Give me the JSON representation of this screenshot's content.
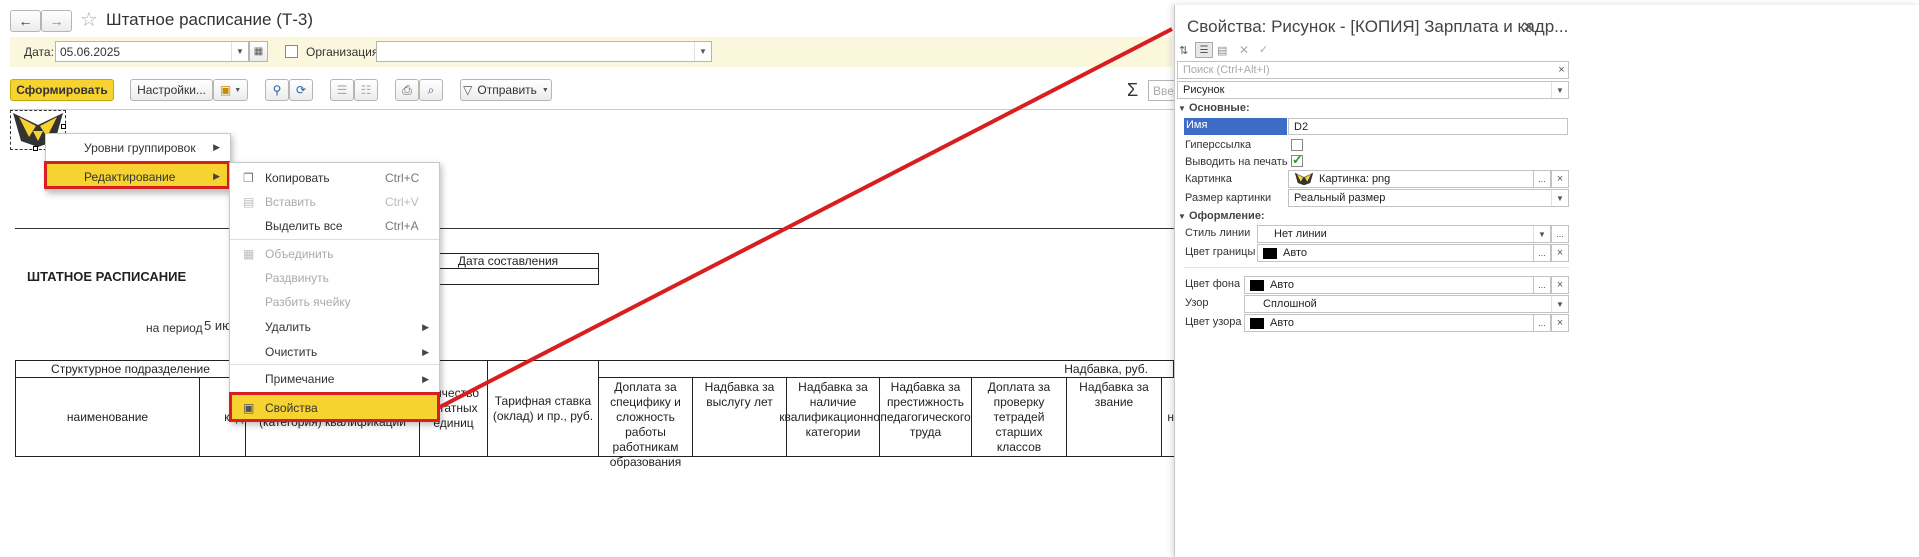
{
  "window": {
    "title": "Штатное расписание (Т-3)"
  },
  "filter": {
    "date_label": "Дата:",
    "date_value": "05.06.2025",
    "org_label": "Организация:",
    "org_value": ""
  },
  "toolbar": {
    "generate_label": "Сформировать",
    "settings_label": "Настройки...",
    "send_label": "Отправить",
    "sigma": "Σ",
    "search_placeholder": "Введ"
  },
  "context_menu": {
    "items": [
      {
        "label": "Уровни группировок",
        "arrow": "▶"
      },
      {
        "label": "Редактирование",
        "arrow": "▶"
      }
    ]
  },
  "edit_menu": {
    "items": [
      {
        "label": "Копировать",
        "shortcut": "Ctrl+C"
      },
      {
        "label": "Вставить",
        "shortcut": "Ctrl+V"
      },
      {
        "label": "Выделить все",
        "shortcut": "Ctrl+A"
      },
      {
        "label": "Объединить"
      },
      {
        "label": "Раздвинуть"
      },
      {
        "label": "Разбить ячейку"
      },
      {
        "label": "Удалить",
        "arrow": "▶"
      },
      {
        "label": "Очистить",
        "arrow": "▶"
      },
      {
        "label": "Примечание",
        "arrow": "▶"
      },
      {
        "label": "Свойства"
      }
    ]
  },
  "report": {
    "title": "ШТАТНОЕ РАСПИСАНИЕ",
    "period_label": "на период",
    "period_value": "5 ию",
    "date_header": "Дата составления",
    "struct_unit": "Структурное  подразделение",
    "col_name": "наименование",
    "col_code": "код",
    "col_qual": "(категория) квалификации",
    "col_units": "личество штатных единиц",
    "col_rate": "Тарифная ставка (оклад) и пр., руб.",
    "allowance_header": "Надбавка, руб.",
    "allowances": [
      "Доплата за специфику и сложность работы работникам образования",
      "Надбавка за выслугу лет",
      "Надбавка за наличие квалификационной категории",
      "Надбавка за престижность педагогического труда",
      "Доплата за проверку тетрадей старших классов",
      "Надбавка за звание"
    ],
    "last_col_fragment": "н"
  },
  "properties": {
    "title": "Свойства: Рисунок - [КОПИЯ] Зарплата и кадр...",
    "close": "✕",
    "search_placeholder": "Поиск (Ctrl+Alt+I)",
    "object_type": "Рисунок",
    "section_main": "Основные:",
    "section_design": "Оформление:",
    "rows": {
      "name": {
        "label": "Имя",
        "value": "D2"
      },
      "hyperlink": {
        "label": "Гиперссылка"
      },
      "print": {
        "label": "Выводить на печать"
      },
      "picture": {
        "label": "Картинка",
        "value": "Картинка: png"
      },
      "picture_size": {
        "label": "Размер картинки",
        "value": "Реальный размер"
      },
      "line_style": {
        "label": "Стиль линии",
        "value": "Нет линии"
      },
      "border_color": {
        "label": "Цвет границы",
        "value": "Авто"
      },
      "bg_color": {
        "label": "Цвет фона",
        "value": "Авто"
      },
      "pattern": {
        "label": "Узор",
        "value": "Сплошной"
      },
      "pattern_color": {
        "label": "Цвет узора",
        "value": "Авто"
      }
    },
    "btn_more": "...",
    "btn_clear": "×",
    "checkmark": "✓"
  },
  "colors": {
    "accent_yellow": "#f6d330",
    "highlight_red": "#d81e1e",
    "filter_bg": "#fbf7dd",
    "selected_blue": "#3e6bc6"
  }
}
